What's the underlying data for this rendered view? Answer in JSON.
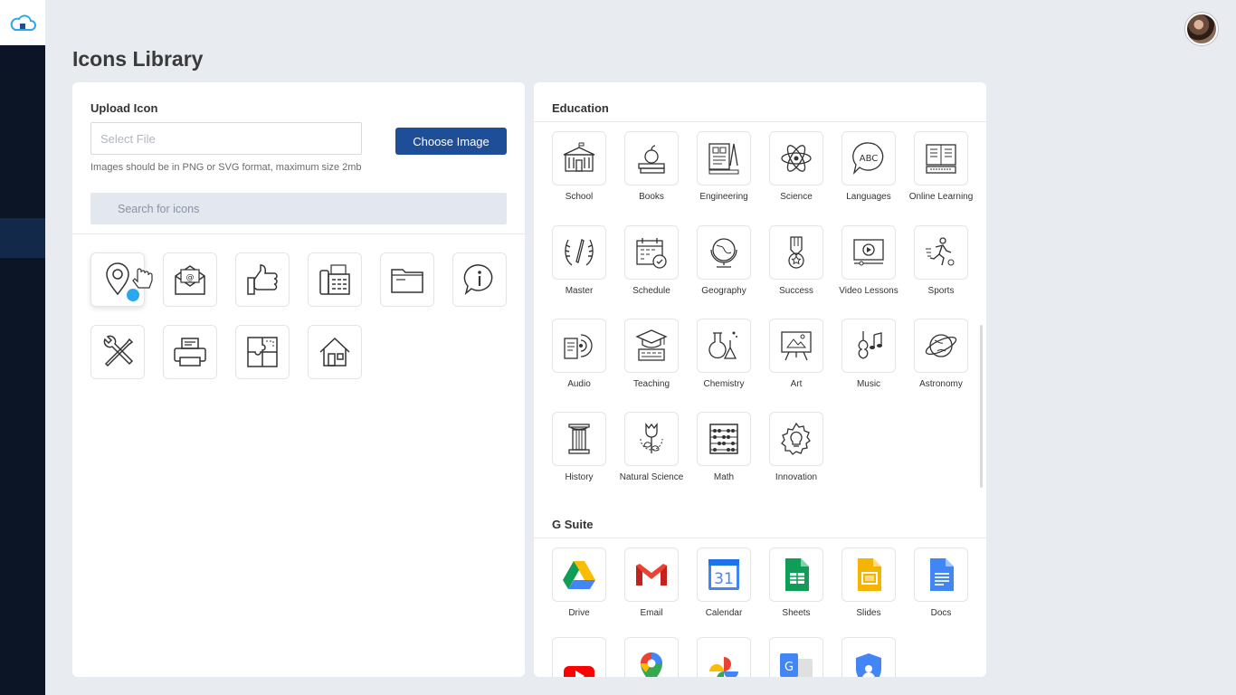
{
  "app": {
    "logo_icon": "cloud-home-icon",
    "avatar": "user-avatar"
  },
  "page": {
    "title": "Icons Library"
  },
  "upload": {
    "label": "Upload Icon",
    "file_placeholder": "Select File",
    "choose_button": "Choose Image",
    "hint": "Images should be in PNG or SVG format, maximum size 2mb",
    "search_placeholder": "Search for icons"
  },
  "uploaded_icons": [
    "location-pin-icon",
    "mail-icon",
    "thumbs-up-icon",
    "fax-icon",
    "folder-icon",
    "info-bubble-icon",
    "tools-icon",
    "printer-icon",
    "puzzle-icon",
    "house-icon"
  ],
  "education": {
    "title": "Education",
    "items": [
      {
        "label": "School",
        "icon": "school-icon"
      },
      {
        "label": "Books",
        "icon": "books-icon"
      },
      {
        "label": "Engineering",
        "icon": "engineering-icon"
      },
      {
        "label": "Science",
        "icon": "atom-icon"
      },
      {
        "label": "Languages",
        "icon": "languages-icon"
      },
      {
        "label": "Online Learning",
        "icon": "online-learning-icon"
      },
      {
        "label": "Master",
        "icon": "laurel-icon"
      },
      {
        "label": "Schedule",
        "icon": "calendar-check-icon"
      },
      {
        "label": "Geography",
        "icon": "globe-icon"
      },
      {
        "label": "Success",
        "icon": "medal-icon"
      },
      {
        "label": "Video Lessons",
        "icon": "video-icon"
      },
      {
        "label": "Sports",
        "icon": "runner-icon"
      },
      {
        "label": "Audio",
        "icon": "audio-icon"
      },
      {
        "label": "Teaching",
        "icon": "teaching-icon"
      },
      {
        "label": "Chemistry",
        "icon": "flask-icon"
      },
      {
        "label": "Art",
        "icon": "easel-icon"
      },
      {
        "label": "Music",
        "icon": "violin-icon"
      },
      {
        "label": "Astronomy",
        "icon": "planet-icon"
      },
      {
        "label": "History",
        "icon": "column-icon"
      },
      {
        "label": "Natural Science",
        "icon": "flower-icon"
      },
      {
        "label": "Math",
        "icon": "abacus-icon"
      },
      {
        "label": "Innovation",
        "icon": "gear-bulb-icon"
      }
    ]
  },
  "gsuite": {
    "title": "G Suite",
    "items": [
      {
        "label": "Drive",
        "icon": "drive-icon"
      },
      {
        "label": "Email",
        "icon": "gmail-icon"
      },
      {
        "label": "Calendar",
        "icon": "calendar-icon",
        "glyph": "31"
      },
      {
        "label": "Sheets",
        "icon": "sheets-icon"
      },
      {
        "label": "Slides",
        "icon": "slides-icon"
      },
      {
        "label": "Docs",
        "icon": "docs-icon"
      },
      {
        "label": "",
        "icon": "youtube-icon"
      },
      {
        "label": "",
        "icon": "maps-icon"
      },
      {
        "label": "",
        "icon": "photos-icon"
      },
      {
        "label": "",
        "icon": "translate-icon",
        "glyph": "G"
      },
      {
        "label": "",
        "icon": "admin-icon"
      }
    ]
  },
  "colors": {
    "primary": "#1f4e99",
    "rail": "#0b1526",
    "background": "#e8ebf0",
    "drop_dot": "#2aa7ee"
  }
}
